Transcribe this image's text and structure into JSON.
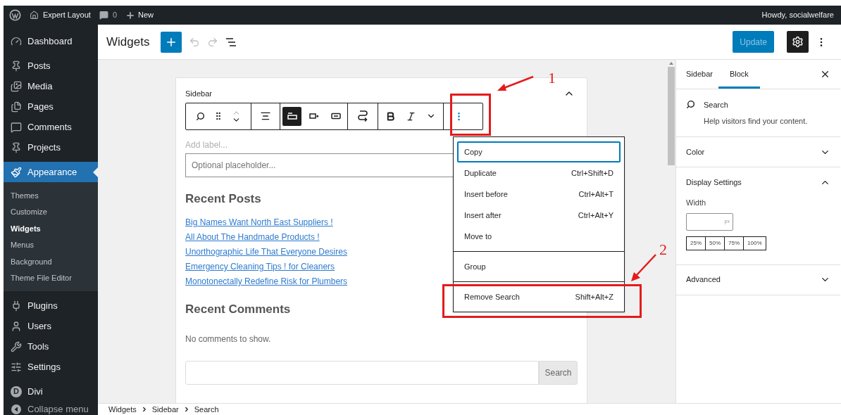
{
  "admin_bar": {
    "site": "Expert Layout",
    "comments": "0",
    "new": "New",
    "greeting": "Howdy, socialwelfare"
  },
  "menu_groups": [
    [
      {
        "label": "Dashboard",
        "selected": false
      }
    ],
    [
      {
        "label": "Posts",
        "selected": false
      },
      {
        "label": "Media",
        "selected": false
      },
      {
        "label": "Pages",
        "selected": false
      },
      {
        "label": "Comments",
        "selected": false
      },
      {
        "label": "Projects",
        "selected": false
      }
    ],
    [
      {
        "label": "Appearance",
        "selected": true,
        "submenu": [
          {
            "label": "Themes",
            "selected": false
          },
          {
            "label": "Customize",
            "selected": false
          },
          {
            "label": "Widgets",
            "selected": true
          },
          {
            "label": "Menus",
            "selected": false
          },
          {
            "label": "Background",
            "selected": false
          },
          {
            "label": "Theme File Editor",
            "selected": false
          }
        ]
      }
    ],
    [
      {
        "label": "Plugins",
        "selected": false
      },
      {
        "label": "Users",
        "selected": false
      },
      {
        "label": "Tools",
        "selected": false
      },
      {
        "label": "Settings",
        "selected": false
      }
    ],
    [
      {
        "label": "Divi",
        "selected": false,
        "logo_letter": "D"
      },
      {
        "label": "Collapse menu",
        "selected": false
      }
    ]
  ],
  "header": {
    "title": "Widgets",
    "update": {
      "label": "Update",
      "disabled": true
    }
  },
  "card": {
    "title": "Sidebar",
    "layout_options": [
      {
        "selected": true
      },
      {
        "selected": false
      },
      {
        "selected": false
      }
    ],
    "label_placeholder": "Add label...",
    "input_placeholder": "Optional placeholder...",
    "recent_posts": {
      "heading": "Recent Posts",
      "links": [
        "Big Names Want North East Suppliers !",
        "All About The Handmade Products !",
        "Unorthographic Life That Everyone Desires",
        "Emergency Cleaning Tips ! for Cleaners",
        "Monotonectally Redefine Risk for Plumbers"
      ]
    },
    "recent_comments": {
      "heading": "Recent Comments",
      "empty": "No comments to show."
    },
    "search_button": "Search"
  },
  "block_menu": [
    [
      {
        "label": "Copy",
        "focused": true
      },
      {
        "label": "Duplicate",
        "shortcut": "Ctrl+Shift+D",
        "focused": false
      },
      {
        "label": "Insert before",
        "shortcut": "Ctrl+Alt+T",
        "focused": false
      },
      {
        "label": "Insert after",
        "shortcut": "Ctrl+Alt+Y",
        "focused": false
      },
      {
        "label": "Move to",
        "focused": false
      }
    ],
    [
      {
        "label": "Group",
        "focused": false
      }
    ],
    [
      {
        "label": "Remove Search",
        "shortcut": "Shift+Alt+Z",
        "focused": false
      }
    ]
  ],
  "settings_panel": {
    "tabs": [
      {
        "label": "Sidebar",
        "selected": false
      },
      {
        "label": "Block",
        "selected": true
      }
    ],
    "block": {
      "name": "Search",
      "description": "Help visitors find your content."
    },
    "sections": [
      {
        "title": "Color",
        "expanded": false
      },
      {
        "title": "Display Settings",
        "expanded": true,
        "width_label": "Width",
        "unit": "px",
        "presets": [
          "25%",
          "50%",
          "75%",
          "100%"
        ]
      },
      {
        "title": "Advanced",
        "expanded": false
      }
    ]
  },
  "breadcrumb": [
    "Widgets",
    "Sidebar",
    "Search"
  ],
  "annotations": [
    {
      "number": "1"
    },
    {
      "number": "2"
    }
  ]
}
